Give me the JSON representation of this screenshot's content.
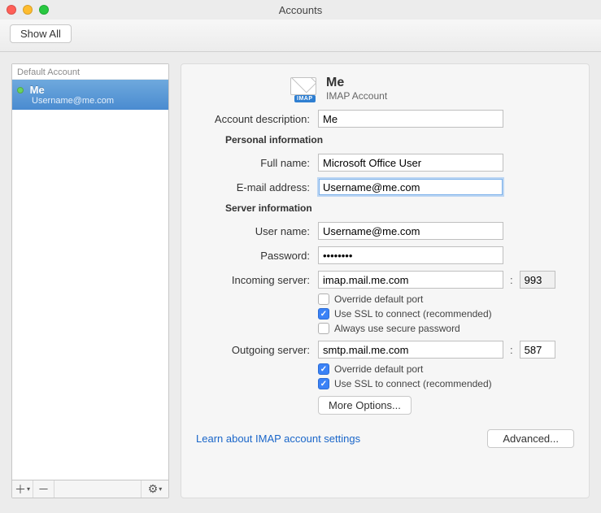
{
  "window": {
    "title": "Accounts",
    "showAllLabel": "Show All"
  },
  "sidebar": {
    "header": "Default Account",
    "account": {
      "name": "Me",
      "sub": "Username@me.com"
    }
  },
  "main": {
    "header": {
      "name": "Me",
      "type": "IMAP Account",
      "imapBadge": "IMAP"
    },
    "labels": {
      "description": "Account description:",
      "fullname": "Full name:",
      "email": "E-mail address:",
      "username": "User name:",
      "password": "Password:",
      "incoming": "Incoming server:",
      "outgoing": "Outgoing server:",
      "personalSection": "Personal information",
      "serverSection": "Server information"
    },
    "values": {
      "description": "Me",
      "fullname": "Microsoft Office User",
      "email": "Username@me.com",
      "username": "Username@me.com",
      "password": "••••••••",
      "incoming": "imap.mail.me.com",
      "incomingPort": "993",
      "outgoing": "smtp.mail.me.com",
      "outgoingPort": "587"
    },
    "checks": {
      "overridePort": "Override default port",
      "useSSL": "Use SSL to connect (recommended)",
      "securePassword": "Always use secure password",
      "incomingOverride": false,
      "incomingSSL": true,
      "incomingSecure": false,
      "outgoingOverride": true,
      "outgoingSSL": true
    },
    "buttons": {
      "moreOptions": "More Options...",
      "advanced": "Advanced..."
    },
    "link": "Learn about IMAP account settings"
  }
}
